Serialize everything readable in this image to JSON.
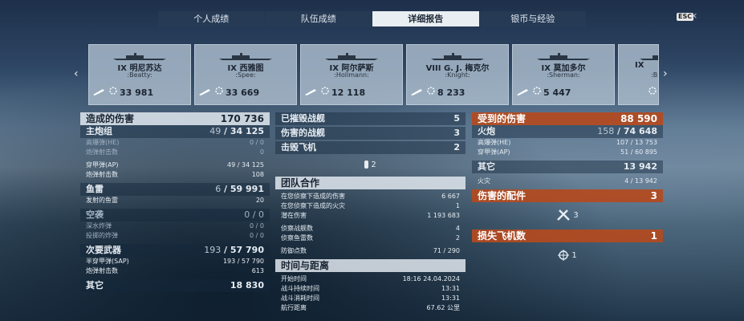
{
  "tabs": [
    {
      "label": "个人成绩",
      "active": false
    },
    {
      "label": "队伍成绩",
      "active": false
    },
    {
      "label": "详细报告",
      "active": true
    },
    {
      "label": "银币与经验",
      "active": false
    }
  ],
  "esc": {
    "label": "ESC",
    "close": "×"
  },
  "nav": {
    "left": "‹",
    "right": "›"
  },
  "ships": [
    {
      "name": "IX 明尼苏达",
      "captain": ":Beatty:",
      "value": "33 981"
    },
    {
      "name": "IX 西雅图",
      "captain": ":Spee:",
      "value": "33 669"
    },
    {
      "name": "IX 阿尔萨斯",
      "captain": ":Hollmann:",
      "value": "12 118"
    },
    {
      "name": "VIII G. J. 梅克尔",
      "captain": ":Knight:",
      "value": "8 233"
    },
    {
      "name": "IX 莫加多尔",
      "captain": ":Sherman:",
      "value": "5 447"
    },
    {
      "name": "IX",
      "captain": ":B",
      "value": ""
    }
  ],
  "left": {
    "header": {
      "label": "造成的伤害",
      "value": "170 736"
    },
    "main": {
      "label": "主炮组",
      "v1": "49",
      "v2": "34 125"
    },
    "he": {
      "label": "高爆弹(HE)",
      "value": "0 / 0"
    },
    "he_shots": {
      "label": "炮弹射击数",
      "value": "0"
    },
    "ap": {
      "label": "穿甲弹(AP)",
      "value": "49 / 34 125"
    },
    "ap_shots": {
      "label": "炮弹射击数",
      "value": "108"
    },
    "torp": {
      "label": "鱼雷",
      "v1": "6",
      "v2": "59 991"
    },
    "torp_fired": {
      "label": "发射的鱼雷",
      "value": "20"
    },
    "air": {
      "label": "空袭",
      "value": "0 / 0"
    },
    "depth": {
      "label": "深水炸弹",
      "value": "0 / 0"
    },
    "bombs": {
      "label": "投掷的炸弹",
      "value": "0 / 0"
    },
    "secondary": {
      "label": "次要武器",
      "v1": "193",
      "v2": "57 790"
    },
    "sap": {
      "label": "半穿甲弹(SAP)",
      "value": "193 / 57 790"
    },
    "sap_shots": {
      "label": "炮弹射击数",
      "value": "613"
    },
    "other": {
      "label": "其它",
      "value": "18 830"
    }
  },
  "middle": {
    "destroyed": {
      "label": "已摧毁战舰",
      "value": "5"
    },
    "damaged": {
      "label": "伤害的战舰",
      "value": "3"
    },
    "planes": {
      "label": "击毁飞机",
      "value": "2"
    },
    "planes_icon_count": "2",
    "team": {
      "label": "团队合作"
    },
    "spot_dmg": {
      "label": "在您侦察下造成的伤害",
      "value": "6 667"
    },
    "spot_fire": {
      "label": "在您侦察下造成的火灾",
      "value": "1"
    },
    "potential": {
      "label": "潜在伤害",
      "value": "1 193 683"
    },
    "spotted_ships": {
      "label": "侦察战舰数",
      "value": "4"
    },
    "spotted_torps": {
      "label": "侦察鱼雷数",
      "value": "2"
    },
    "defense": {
      "label": "防御点数",
      "value": "71 / 290"
    },
    "time": {
      "label": "时间与距离"
    },
    "start": {
      "label": "开始时间",
      "value": "18:16   24.04.2024"
    },
    "duration": {
      "label": "战斗持续时间",
      "value": "13:31"
    },
    "consumed": {
      "label": "战斗消耗时间",
      "value": "13:31"
    },
    "distance": {
      "label": "航行距离",
      "value": "67.62 公里"
    }
  },
  "right": {
    "received": {
      "label": "受到的伤害",
      "value": "88 590"
    },
    "guns": {
      "label": "火炮",
      "v1": "158",
      "v2": "74 648"
    },
    "he": {
      "label": "高爆弹(HE)",
      "value": "107 / 13 753"
    },
    "ap": {
      "label": "穿甲弹(AP)",
      "value": "51 / 60 895"
    },
    "other": {
      "label": "其它",
      "value": "13 942"
    },
    "fire": {
      "label": "火灾",
      "value": "4 / 13 942"
    },
    "modules": {
      "label": "伤害的配件",
      "value": "3"
    },
    "modules_icon_count": "3",
    "planes_lost": {
      "label": "损失飞机数",
      "value": "1"
    },
    "planes_lost_icon_count": "1"
  }
}
